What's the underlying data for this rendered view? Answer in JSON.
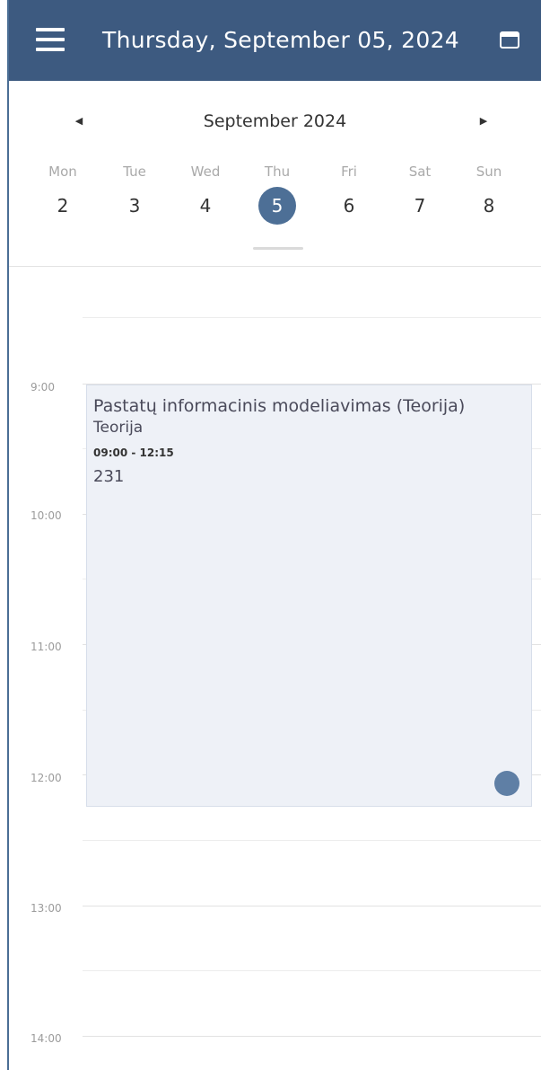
{
  "header": {
    "title": "Thursday, September 05, 2024",
    "menu_icon": "hamburger-menu-icon",
    "calendar_icon": "calendar-icon"
  },
  "week": {
    "month_label": "September 2024",
    "prev_icon": "chevron-left-icon",
    "next_icon": "chevron-right-icon",
    "days": [
      {
        "name": "Mon",
        "num": "2"
      },
      {
        "name": "Tue",
        "num": "3"
      },
      {
        "name": "Wed",
        "num": "4"
      },
      {
        "name": "Thu",
        "num": "5"
      },
      {
        "name": "Fri",
        "num": "6"
      },
      {
        "name": "Sat",
        "num": "7"
      },
      {
        "name": "Sun",
        "num": "8"
      }
    ],
    "selected_day": "5"
  },
  "timeline": {
    "hours": [
      "9:00",
      "10:00",
      "11:00",
      "12:00",
      "13:00",
      "14:00"
    ]
  },
  "event": {
    "title": "Pastatų informacinis modeliavimas (Teorija)",
    "type": "Teorija",
    "time": "09:00 - 12:15",
    "room": "231"
  },
  "colors": {
    "app_bar": "#3d5a80",
    "accent": "#4d6f96",
    "event_bg": "#eef1f7"
  }
}
